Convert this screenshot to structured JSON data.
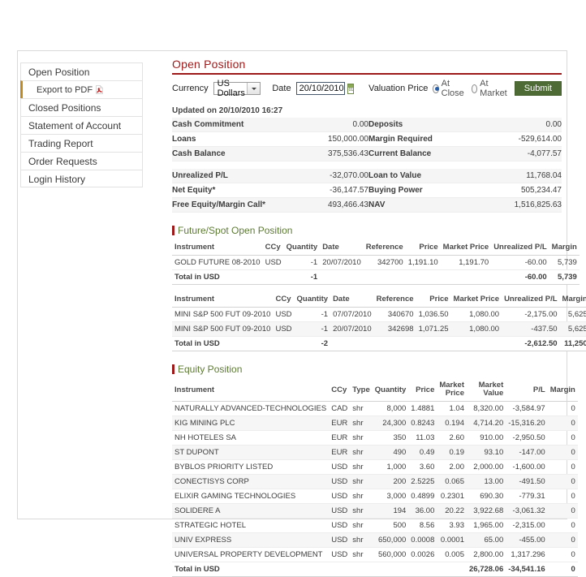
{
  "sidebar": {
    "items": [
      {
        "label": "Open Position",
        "sub": false,
        "icon": null
      },
      {
        "label": "Export to PDF",
        "sub": true,
        "icon": "pdf-icon"
      },
      {
        "label": "Closed Positions",
        "sub": false,
        "icon": null
      },
      {
        "label": "Statement of Account",
        "sub": false,
        "icon": null
      },
      {
        "label": "Trading Report",
        "sub": false,
        "icon": null
      },
      {
        "label": "Order Requests",
        "sub": false,
        "icon": null
      },
      {
        "label": "Login History",
        "sub": false,
        "icon": null
      }
    ]
  },
  "header": {
    "title": "Open Position",
    "accent_color": "#9c1a1a"
  },
  "form": {
    "currency_label": "Currency",
    "currency_value": "US Dollars",
    "currency_options": [
      "US Dollars"
    ],
    "date_label": "Date",
    "date_value": "20/10/2010",
    "calendar_icon": "calendar-icon",
    "valuation_label": "Valuation Price",
    "radio_at_close": "At Close",
    "radio_at_market": "At Market",
    "selected_valuation": "At Close",
    "submit_label": "Submit",
    "submit_color": "#4e6b35"
  },
  "updated": "Updated on 20/10/2010 16:27",
  "summary": {
    "group1": [
      {
        "label": "Cash Commitment",
        "value": "0.00",
        "label2": "Deposits",
        "value2": "0.00"
      },
      {
        "label": "Loans",
        "value": "150,000.00",
        "label2": "Margin Required",
        "value2": "-529,614.00"
      },
      {
        "label": "Cash Balance",
        "value": "375,536.43",
        "label2": "Current Balance",
        "value2": "-4,077.57"
      }
    ],
    "group2": [
      {
        "label": "Unrealized P/L",
        "value": "-32,070.00",
        "label2": "Loan to Value",
        "value2": "11,768.04"
      },
      {
        "label": "Net Equity*",
        "value": "-36,147.57",
        "label2": "Buying Power",
        "value2": "505,234.47"
      },
      {
        "label": "Free Equity/Margin Call*",
        "value": "493,466.43",
        "label2": "NAV",
        "value2": "1,516,825.63"
      }
    ]
  },
  "futures_section": {
    "heading": "Future/Spot Open Position",
    "columns": [
      "Instrument",
      "CCy",
      "Quantity",
      "Date",
      "Reference",
      "Price",
      "Market Price",
      "Unrealized P/L",
      "Margin"
    ],
    "tables": [
      {
        "rows": [
          {
            "instrument": "GOLD FUTURE 08-2010",
            "ccy": "USD",
            "quantity": "-1",
            "date": "20/07/2010",
            "reference": "342700",
            "price": "1,191.10",
            "market_price": "1,191.70",
            "unrealized_pl": "-60.00",
            "margin": "5,739"
          }
        ],
        "total": {
          "label": "Total in USD",
          "quantity": "-1",
          "unrealized_pl": "-60.00",
          "margin": "5,739"
        }
      },
      {
        "rows": [
          {
            "instrument": "MINI S&P 500 FUT 09-2010",
            "ccy": "USD",
            "quantity": "-1",
            "date": "07/07/2010",
            "reference": "340670",
            "price": "1,036.50",
            "market_price": "1,080.00",
            "unrealized_pl": "-2,175.00",
            "margin": "5,625"
          },
          {
            "instrument": "MINI S&P 500 FUT 09-2010",
            "ccy": "USD",
            "quantity": "-1",
            "date": "20/07/2010",
            "reference": "342698",
            "price": "1,071.25",
            "market_price": "1,080.00",
            "unrealized_pl": "-437.50",
            "margin": "5,625"
          }
        ],
        "total": {
          "label": "Total in USD",
          "quantity": "-2",
          "unrealized_pl": "-2,612.50",
          "margin": "11,250"
        }
      }
    ]
  },
  "equity_section": {
    "heading": "Equity Position",
    "columns": [
      "Instrument",
      "CCy",
      "Type",
      "Quantity",
      "Price",
      "Market Price",
      "Market Value",
      "P/L",
      "Margin"
    ],
    "rows": [
      {
        "instrument": "NATURALLY ADVANCED-TECHNOLOGIES",
        "ccy": "CAD",
        "type": "shr",
        "quantity": "8,000",
        "price": "1.4881",
        "market_price": "1.04",
        "market_value": "8,320.00",
        "pl": "-3,584.97",
        "margin": "0"
      },
      {
        "instrument": "KIG MINING PLC",
        "ccy": "EUR",
        "type": "shr",
        "quantity": "24,300",
        "price": "0.8243",
        "market_price": "0.194",
        "market_value": "4,714.20",
        "pl": "-15,316.20",
        "margin": "0"
      },
      {
        "instrument": "NH HOTELES SA",
        "ccy": "EUR",
        "type": "shr",
        "quantity": "350",
        "price": "11.03",
        "market_price": "2.60",
        "market_value": "910.00",
        "pl": "-2,950.50",
        "margin": "0"
      },
      {
        "instrument": "ST DUPONT",
        "ccy": "EUR",
        "type": "shr",
        "quantity": "490",
        "price": "0.49",
        "market_price": "0.19",
        "market_value": "93.10",
        "pl": "-147.00",
        "margin": "0"
      },
      {
        "instrument": "BYBLOS PRIORITY LISTED",
        "ccy": "USD",
        "type": "shr",
        "quantity": "1,000",
        "price": "3.60",
        "market_price": "2.00",
        "market_value": "2,000.00",
        "pl": "-1,600.00",
        "margin": "0"
      },
      {
        "instrument": "CONECTISYS CORP",
        "ccy": "USD",
        "type": "shr",
        "quantity": "200",
        "price": "2.5225",
        "market_price": "0.065",
        "market_value": "13.00",
        "pl": "-491.50",
        "margin": "0"
      },
      {
        "instrument": "ELIXIR GAMING TECHNOLOGIES",
        "ccy": "USD",
        "type": "shr",
        "quantity": "3,000",
        "price": "0.4899",
        "market_price": "0.2301",
        "market_value": "690.30",
        "pl": "-779.31",
        "margin": "0"
      },
      {
        "instrument": "SOLIDERE A",
        "ccy": "USD",
        "type": "shr",
        "quantity": "194",
        "price": "36.00",
        "market_price": "20.22",
        "market_value": "3,922.68",
        "pl": "-3,061.32",
        "margin": "0"
      },
      {
        "instrument": "STRATEGIC HOTEL",
        "ccy": "USD",
        "type": "shr",
        "quantity": "500",
        "price": "8.56",
        "market_price": "3.93",
        "market_value": "1,965.00",
        "pl": "-2,315.00",
        "margin": "0"
      },
      {
        "instrument": "UNIV EXPRESS",
        "ccy": "USD",
        "type": "shr",
        "quantity": "650,000",
        "price": "0.0008",
        "market_price": "0.0001",
        "market_value": "65.00",
        "pl": "-455.00",
        "margin": "0"
      },
      {
        "instrument": "UNIVERSAL PROPERTY DEVELOPMENT",
        "ccy": "USD",
        "type": "shr",
        "quantity": "560,000",
        "price": "0.0026",
        "market_price": "0.005",
        "market_value": "2,800.00",
        "pl": "1,317.296",
        "margin": "0"
      }
    ],
    "total": {
      "label": "Total in USD",
      "market_value": "26,728.06",
      "pl": "-34,541.16",
      "margin": "0"
    }
  }
}
